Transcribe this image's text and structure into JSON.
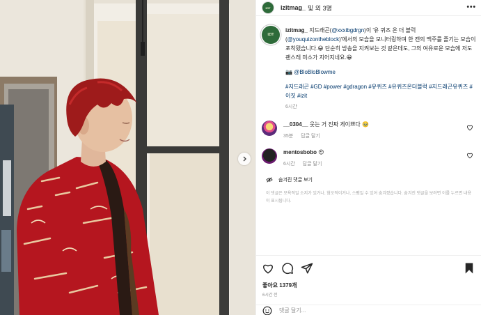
{
  "header": {
    "username": "izitmag_",
    "tail": "및 외 3명",
    "more": "•••",
    "avatar_text": "IZIT"
  },
  "caption": {
    "avatar_text": "IZIT",
    "username": "izitmag_",
    "text_1": " 지드래곤(",
    "mention_1": "@xxxibgdrgn",
    "text_2": ")이 '유 퀴즈 온 더 블럭(",
    "mention_2": "@youquizontheblock",
    "text_3": ")'에서의 모습을 모니터링하며 한 캔의 맥주를 즐기는 모습이 포착됐습니다.😀 단순히 방송을 지켜보는 것 같은데도, 그의 여유로운 모습에 저도 괜스레 미소가 지어지네요.😀",
    "camera": "📷",
    "mention_3": "@BloBloBlowme",
    "hashtags": "#지드래곤 #GD #power #gdragon #유퀴즈 #유퀴즈온더블럭 #지드래곤유퀴즈 #이짓 #izit",
    "time": "6시간"
  },
  "comments": [
    {
      "username": "__0304__",
      "text": "웃는 거 진짜 게이쁘다 🥹",
      "time": "35분",
      "reply": "답글 달기"
    },
    {
      "username": "mentosbobo",
      "text": "😍",
      "time": "6시간",
      "reply": "답글 달기"
    }
  ],
  "hidden": {
    "label": "숨겨진 댓글 보기",
    "note": "이 댓글은 모욕적일 소지가 있거나, 혐오적이거나, 스팸일 수 있어 숨겨졌습니다. 숨겨진 댓글을 보려면 이를 누르면 내용이 표시됩니다."
  },
  "actions": {
    "likes": "좋아요 1379개",
    "time": "6시간 전",
    "comment_placeholder": "댓글 달기..."
  },
  "colors": {
    "link": "#00376b",
    "muted": "#8e8e8e",
    "shirt": "#b5161f",
    "hair": "#9e1b1b"
  },
  "icons": [
    "more-icon",
    "heart-icon",
    "comment-icon",
    "share-icon",
    "bookmark-icon",
    "emoji-icon",
    "hidden-eye-icon",
    "chevron-right-icon"
  ]
}
